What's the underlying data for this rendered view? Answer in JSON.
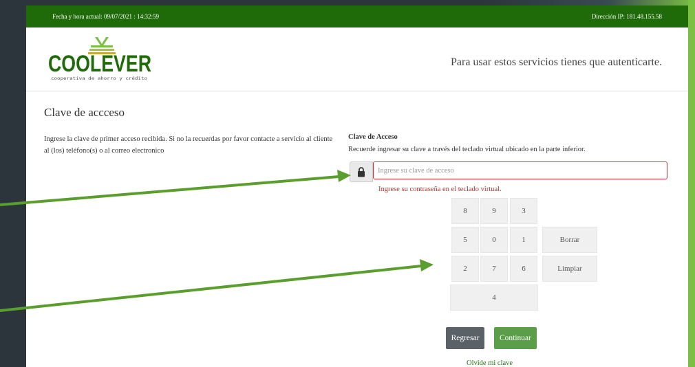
{
  "topbar": {
    "datetime": "Fecha y hora actual: 09/07/2021 : 14:32:59",
    "ip": "Dirección IP: 181.48.155.58"
  },
  "header": {
    "logo_name": "COOLEVER",
    "logo_tagline": "cooperativa de ahorro y crédito",
    "auth_message": "Para usar estos servicios tienes que autenticarte."
  },
  "main": {
    "title": "Clave de accceso",
    "instructions": "Ingrese la clave de primer acceso recibida. Si no la recuerdas por favor contacte a servicio al cliente al (los) teléfono(s) o al correo electronico",
    "field_label": "Clave de Acceso",
    "field_hint": "Recuerde ingresar su clave a través del teclado virtual ubicado en la parte inferior.",
    "password_placeholder": "Ingrese su clave de acceso",
    "password_value": "",
    "error": "Ingrese su contraseña en el teclado virtual."
  },
  "keypad": {
    "row1": [
      "8",
      "9",
      "3"
    ],
    "row2": [
      "5",
      "0",
      "1"
    ],
    "row3": [
      "2",
      "7",
      "6"
    ],
    "row4": [
      "4"
    ],
    "delete_label": "Borrar",
    "clear_label": "Limpiar"
  },
  "actions": {
    "back_label": "Regresar",
    "continue_label": "Continuar",
    "forgot_label": "Olvide mi clave"
  },
  "colors": {
    "brand_green": "#1f6b0a",
    "accent_green": "#7bc043",
    "error_red": "#d9262f",
    "button_gray": "#5a6268",
    "button_green": "#5a9e4a"
  },
  "icons": {
    "lock": "lock-icon",
    "annotation_arrows": "arrow-icon"
  }
}
